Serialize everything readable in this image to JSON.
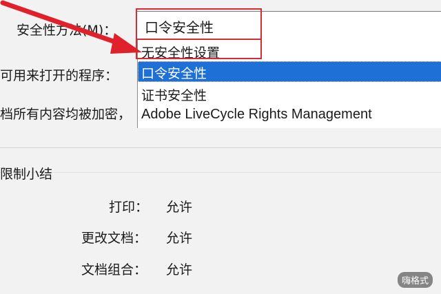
{
  "security_method": {
    "label": "安全性方法(M)：",
    "selected_value": "口令安全性",
    "options": [
      {
        "label": "无安全性设置"
      },
      {
        "label": "口令安全性",
        "highlighted": true
      },
      {
        "label": "证书安全性"
      },
      {
        "label": "Adobe LiveCycle Rights Management"
      }
    ]
  },
  "partial_labels": {
    "open_with": "可用来打开的程序：",
    "encrypted": "档所有内容均被加密，"
  },
  "restrictions": {
    "heading": "限制小结",
    "rows": [
      {
        "name": "打印：",
        "value": "允许"
      },
      {
        "name": "更改文档：",
        "value": "允许"
      },
      {
        "name": "文档组合：",
        "value": "允许"
      }
    ]
  },
  "watermark": "嗨格式",
  "colors": {
    "highlight": "#1e6fd6",
    "annotation_red": "#d42c35"
  }
}
